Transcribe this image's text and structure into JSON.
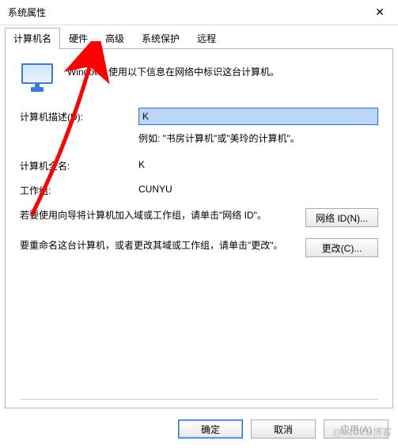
{
  "window": {
    "title": "系统属性"
  },
  "tabs": {
    "computer_name": "计算机名",
    "hardware": "硬件",
    "advanced": "高级",
    "system_protection": "系统保护",
    "remote": "远程"
  },
  "intro": "Windows 使用以下信息在网络中标识这台计算机。",
  "form": {
    "description_label": "计算机描述(D):",
    "description_value": "K",
    "description_hint": "例如: \"书房计算机\"或\"美玲的计算机\"。",
    "full_name_label": "计算机全名:",
    "full_name_value": "K",
    "workgroup_label": "工作组:",
    "workgroup_value": "CUNYU"
  },
  "sections": {
    "network_id_text": "若要使用向导将计算机加入域或工作组，请单击\"网络 ID\"。",
    "network_id_button": "网络 ID(N)...",
    "change_text": "要重命名这台计算机，或者更改其域或工作组，请单击\"更改\"。",
    "change_button": "更改(C)..."
  },
  "footer": {
    "ok": "确定",
    "cancel": "取消",
    "apply": "应用(A)"
  },
  "watermark": "@51CTO博客"
}
